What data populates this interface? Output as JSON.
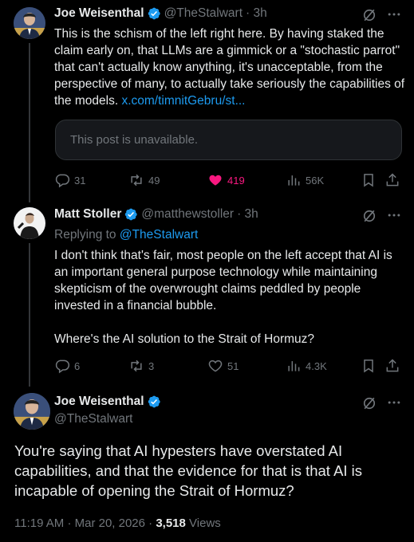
{
  "tweet1": {
    "name": "Joe Weisenthal",
    "handle": "@TheStalwart",
    "time": "· 3h",
    "text": "This is the schism of the left right here. By having staked the claim early on, that LLMs are a gimmick or a \"stochastic parrot\" that can't actually know anything, it's unacceptable, from the perspective of many, to actually take seriously the capabilities of the models.",
    "link": "x.com/timnitGebru/st...",
    "quote_unavailable": "This post is unavailable.",
    "replies": "31",
    "reposts": "49",
    "likes": "419",
    "views": "56K"
  },
  "tweet2": {
    "name": "Matt Stoller",
    "handle": "@matthewstoller",
    "time": "· 3h",
    "replying_prefix": "Replying to",
    "replying_to": "@TheStalwart",
    "text_p1": "I don't think that's fair, most people on the left accept that AI is an important general purpose technology while maintaining skepticism of the overwrought claims peddled by people invested in a financial bubble.",
    "text_p2": "Where's the AI solution to the Strait of Hormuz?",
    "replies": "6",
    "reposts": "3",
    "likes": "51",
    "views": "4.3K"
  },
  "tweet3": {
    "name": "Joe Weisenthal",
    "handle": "@TheStalwart",
    "text": "You're saying that AI hypesters have overstated AI capabilities, and that the evidence for that is that AI is incapable of opening the Strait of Hormuz?",
    "time": "11:19 AM",
    "date": "· Mar 20, 2026 ·",
    "views_count": "3,518",
    "views_label": "Views"
  },
  "icons": {
    "verified": "verified-badge-icon",
    "grok": "grok-icon",
    "more": "more-icon",
    "reply": "reply-icon",
    "repost": "repost-icon",
    "like": "heart-icon",
    "views": "views-icon",
    "bookmark": "bookmark-icon",
    "share": "share-icon"
  },
  "colors": {
    "background": "#000000",
    "text": "#e7e9ea",
    "muted": "#71767b",
    "link": "#1d9bf0",
    "like": "#f91880"
  }
}
